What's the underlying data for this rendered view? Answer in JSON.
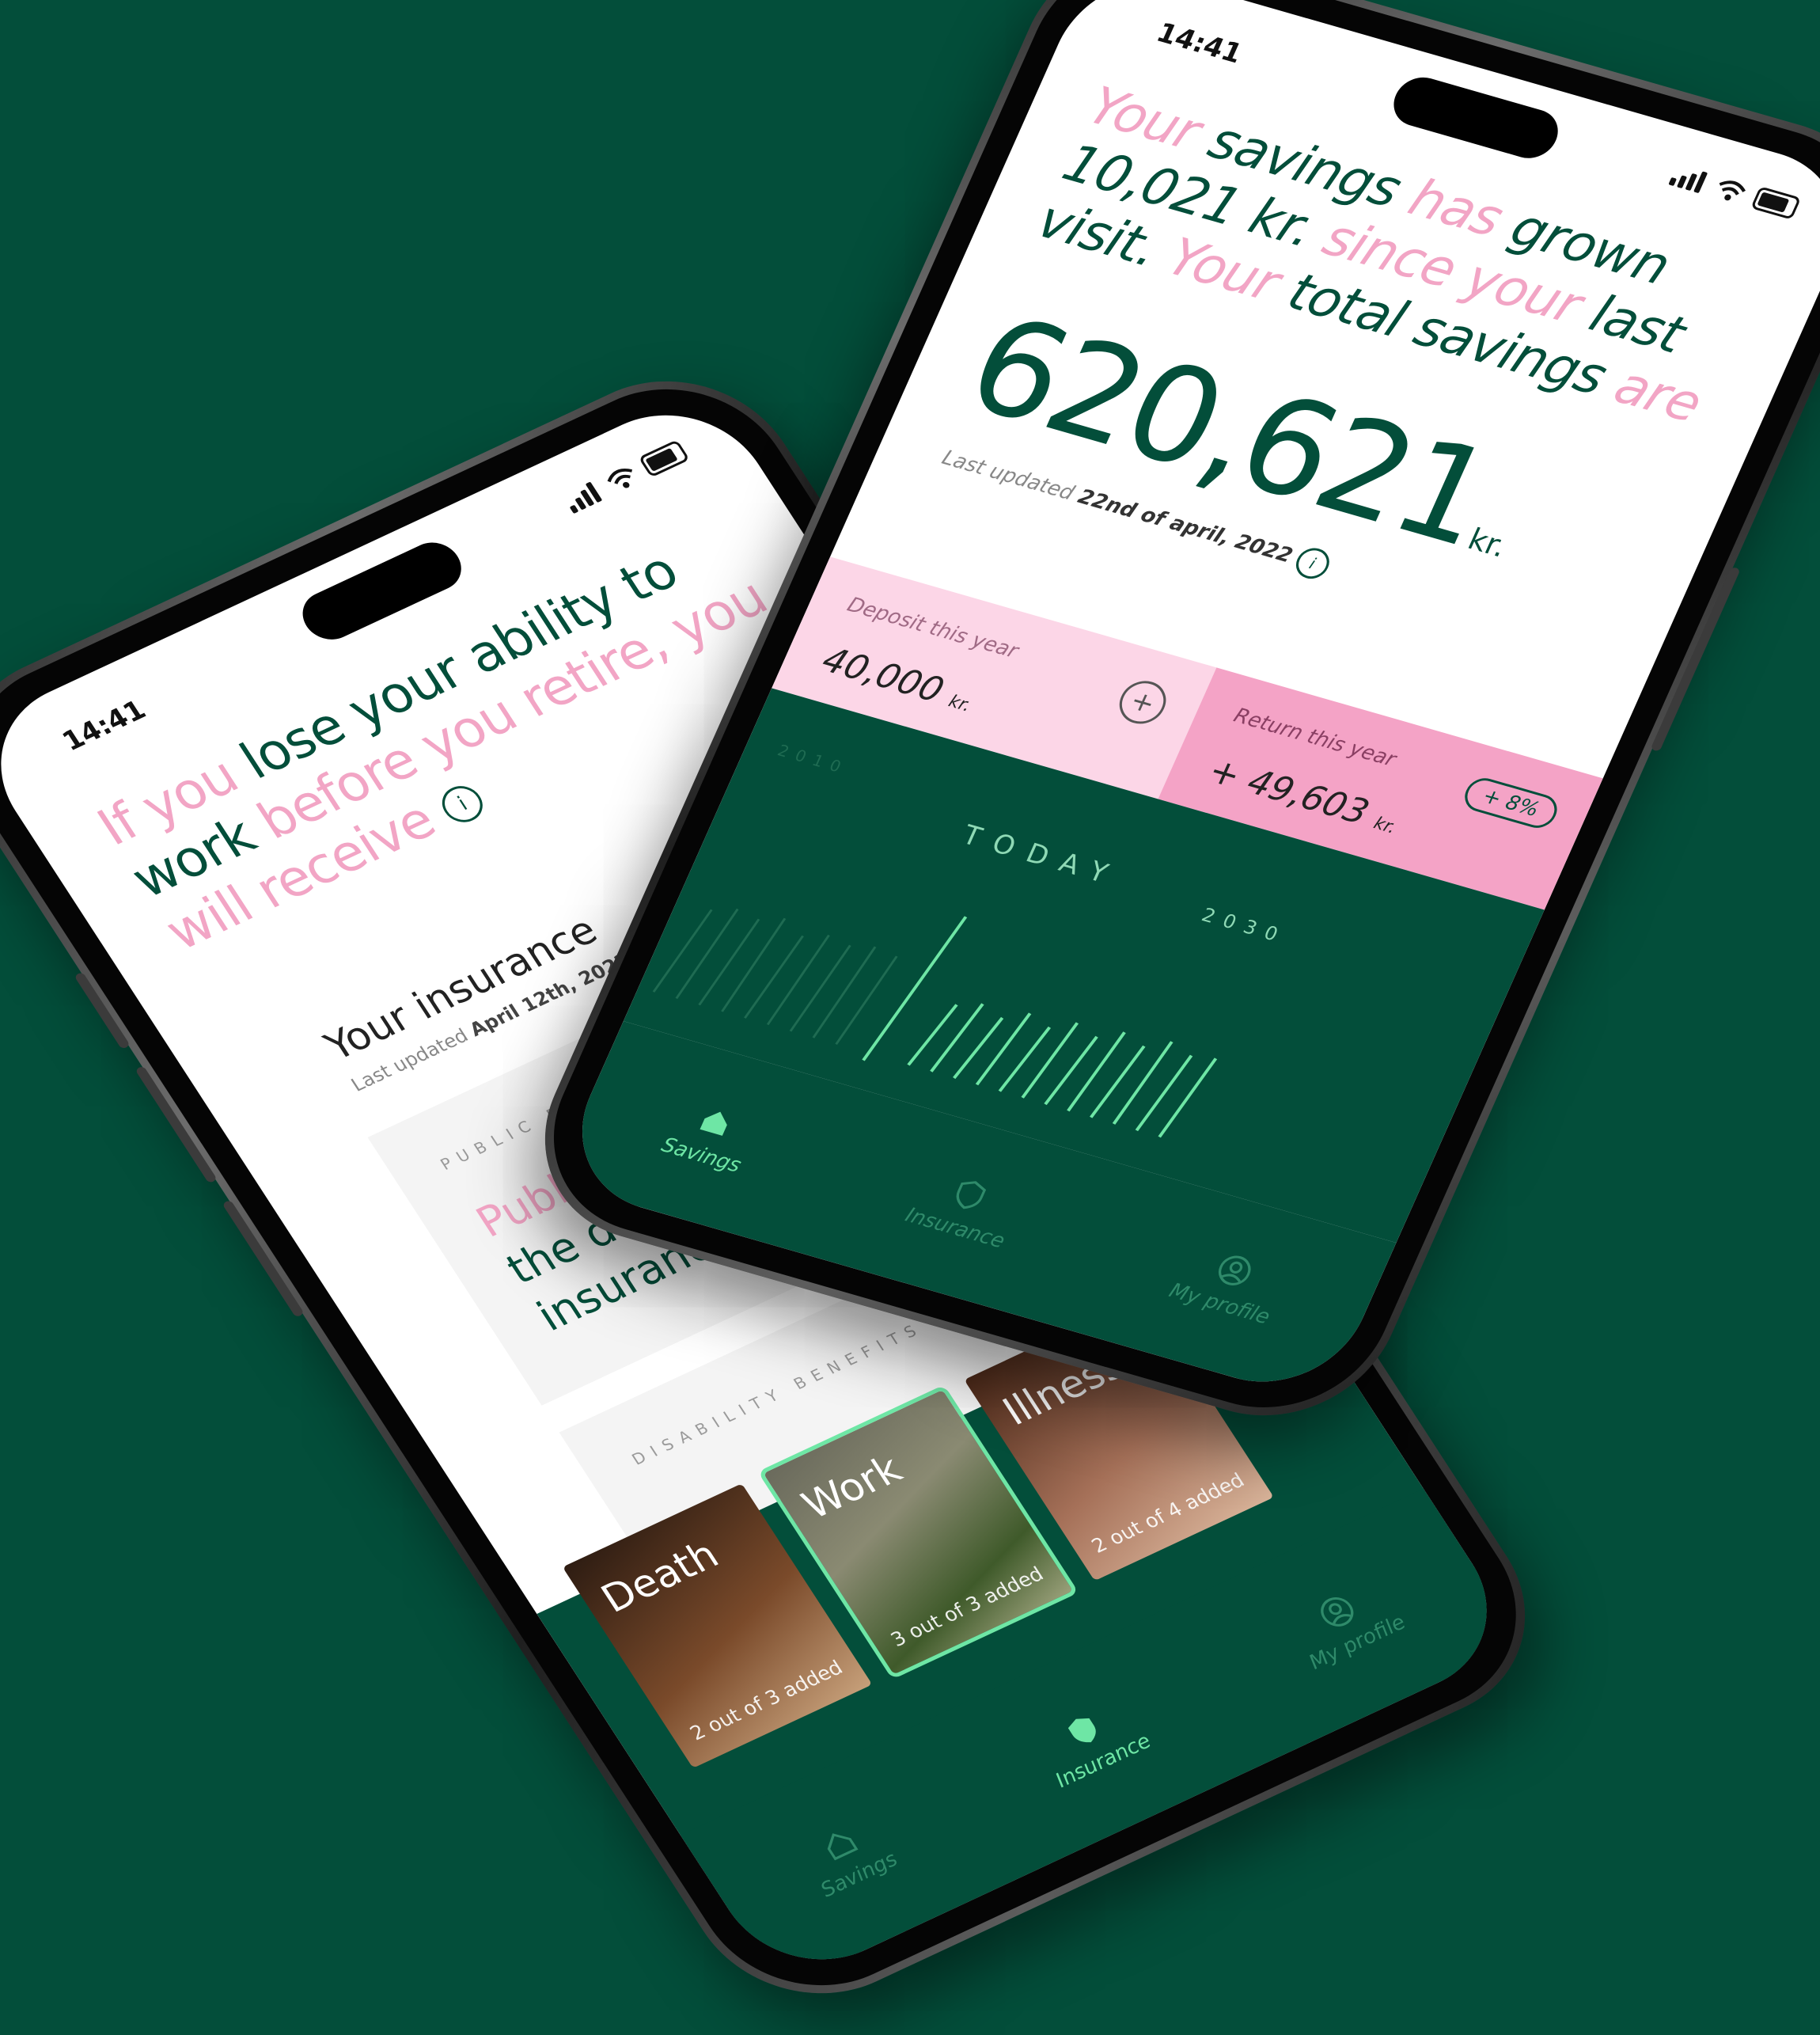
{
  "colors": {
    "background": "#034e3a",
    "pink": "#f2a5c5",
    "green": "#034e3a",
    "accent": "#6ee6a5"
  },
  "insurance_phone": {
    "time": "14:41",
    "headline": [
      {
        "text": "If you ",
        "tone": "pink"
      },
      {
        "text": "lose your ability to work ",
        "tone": "green"
      },
      {
        "text": "before you retire, you will receive",
        "tone": "pink"
      }
    ],
    "section_title": "Your insurance",
    "last_updated_label": "Last updated",
    "last_updated_value": "April 12th, 2022",
    "public_benefits_label": "PUBLIC BENEFITS",
    "public_benefits_text_pink": "Public benefits co",
    "public_benefits_text_green_1": "the difference b",
    "public_benefits_text_green_2": "insurance a",
    "disability_benefits_label": "DISABILITY BENEFITS",
    "cards": [
      {
        "title": "Death",
        "subtitle": "2 out of 3 added"
      },
      {
        "title": "Work",
        "subtitle": "3 out of 3 added"
      },
      {
        "title": "Illness",
        "subtitle": "2 out of 4 added"
      }
    ],
    "tabs": [
      {
        "label": "Savings",
        "icon": "home-icon",
        "active": false
      },
      {
        "label": "Insurance",
        "icon": "shield-icon",
        "active": true
      },
      {
        "label": "My profile",
        "icon": "profile-icon",
        "active": false
      }
    ]
  },
  "savings_phone": {
    "time": "14:41",
    "headline": [
      {
        "text": "Your ",
        "tone": "pink"
      },
      {
        "text": "savings ",
        "tone": "green"
      },
      {
        "text": "has ",
        "tone": "pink"
      },
      {
        "text": "grown 10,021 kr. ",
        "tone": "green"
      },
      {
        "text": "since your ",
        "tone": "pink"
      },
      {
        "text": "last visit. ",
        "tone": "green"
      },
      {
        "text": "Your ",
        "tone": "pink"
      },
      {
        "text": "total savings ",
        "tone": "green"
      },
      {
        "text": "are",
        "tone": "pink"
      }
    ],
    "total_value": "620,621",
    "total_unit": "kr.",
    "last_updated_label": "Last updated",
    "last_updated_value": "22nd of april, 2022",
    "deposit_label": "Deposit this year",
    "deposit_value": "40,000",
    "deposit_unit": "kr.",
    "return_label": "Return this year",
    "return_badge": "+ 8%",
    "return_value": "+ 49,603",
    "return_unit": "kr.",
    "timeline_start": "2010",
    "timeline_today": "TODAY",
    "timeline_end": "2030",
    "tabs": [
      {
        "label": "Savings",
        "icon": "home-icon",
        "active": true
      },
      {
        "label": "Insurance",
        "icon": "shield-icon",
        "active": false
      },
      {
        "label": "My profile",
        "icon": "profile-icon",
        "active": false
      }
    ]
  }
}
